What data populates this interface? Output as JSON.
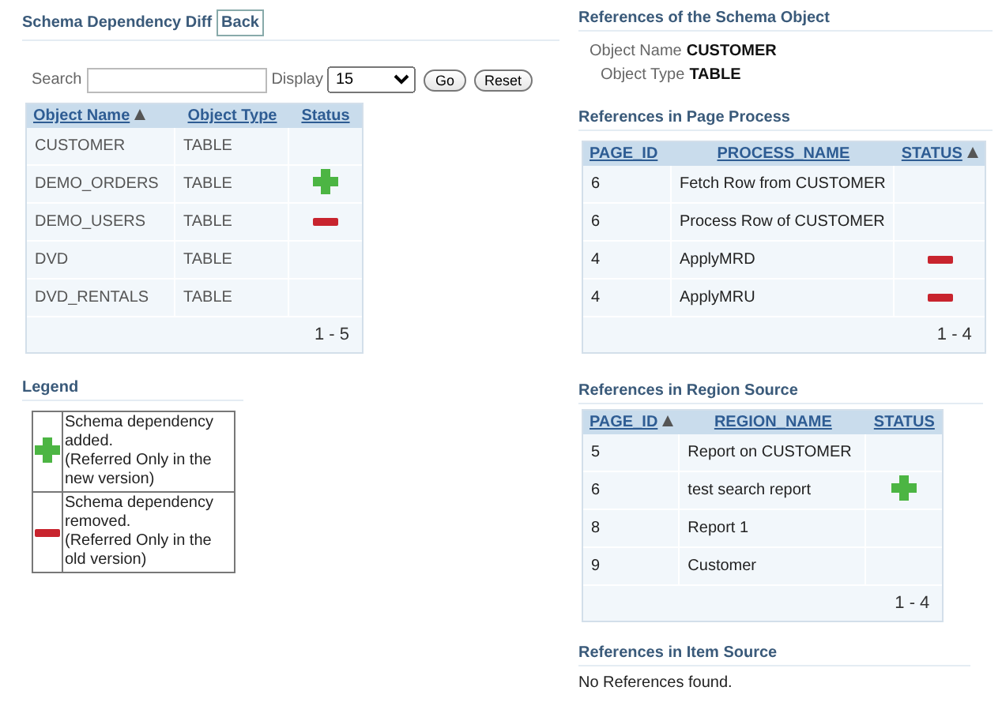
{
  "title": "Schema Dependency Diff",
  "back_button": "Back",
  "search": {
    "label": "Search",
    "display_label": "Display",
    "display_value": "15",
    "go_button": "Go",
    "reset_button": "Reset"
  },
  "objects_table": {
    "columns": [
      {
        "label": "Object Name",
        "sorted": true
      },
      {
        "label": "Object Type",
        "sorted": false
      },
      {
        "label": "Status",
        "sorted": false
      }
    ],
    "rows": [
      {
        "cells": [
          "CUSTOMER",
          "TABLE"
        ],
        "kind": "none"
      },
      {
        "cells": [
          "DEMO_ORDERS",
          "TABLE"
        ],
        "kind": "added"
      },
      {
        "cells": [
          "DEMO_USERS",
          "TABLE"
        ],
        "kind": "removed"
      },
      {
        "cells": [
          "DVD",
          "TABLE"
        ],
        "kind": "none"
      },
      {
        "cells": [
          "DVD_RENTALS",
          "TABLE"
        ],
        "kind": "none"
      }
    ],
    "pagination": "1 - 5"
  },
  "legend": {
    "title": "Legend",
    "items": [
      {
        "kind": "added",
        "text": "Schema dependency added.\n(Referred Only in the new version)"
      },
      {
        "kind": "removed",
        "text": "Schema dependency removed.\n(Referred Only in the old version)"
      }
    ]
  },
  "schema_object": {
    "title": "References of the Schema Object",
    "fields": [
      {
        "label": "Object Name",
        "value": "CUSTOMER"
      },
      {
        "label": "Object Type",
        "value": "TABLE"
      }
    ]
  },
  "page_process": {
    "title": "References in Page Process",
    "columns": [
      {
        "label": "PAGE_ID",
        "sorted": false
      },
      {
        "label": "PROCESS_NAME",
        "sorted": false
      },
      {
        "label": "STATUS",
        "sorted": true
      }
    ],
    "rows": [
      {
        "cells": [
          "6",
          "Fetch Row from CUSTOMER"
        ],
        "kind": "none"
      },
      {
        "cells": [
          "6",
          "Process Row of CUSTOMER"
        ],
        "kind": "none"
      },
      {
        "cells": [
          "4",
          "ApplyMRD"
        ],
        "kind": "removed"
      },
      {
        "cells": [
          "4",
          "ApplyMRU"
        ],
        "kind": "removed"
      }
    ],
    "pagination": "1 - 4"
  },
  "region_source": {
    "title": "References in Region Source",
    "columns": [
      {
        "label": "PAGE_ID",
        "sorted": true
      },
      {
        "label": "REGION_NAME",
        "sorted": false
      },
      {
        "label": "STATUS",
        "sorted": false
      }
    ],
    "rows": [
      {
        "cells": [
          "5",
          "Report on CUSTOMER"
        ],
        "kind": "none"
      },
      {
        "cells": [
          "6",
          "test search report"
        ],
        "kind": "added"
      },
      {
        "cells": [
          "8",
          "Report 1"
        ],
        "kind": "none"
      },
      {
        "cells": [
          "9",
          "Customer"
        ],
        "kind": "none"
      }
    ],
    "pagination": "1 - 4"
  },
  "item_source": {
    "title": "References in Item Source",
    "message": "No References found."
  }
}
